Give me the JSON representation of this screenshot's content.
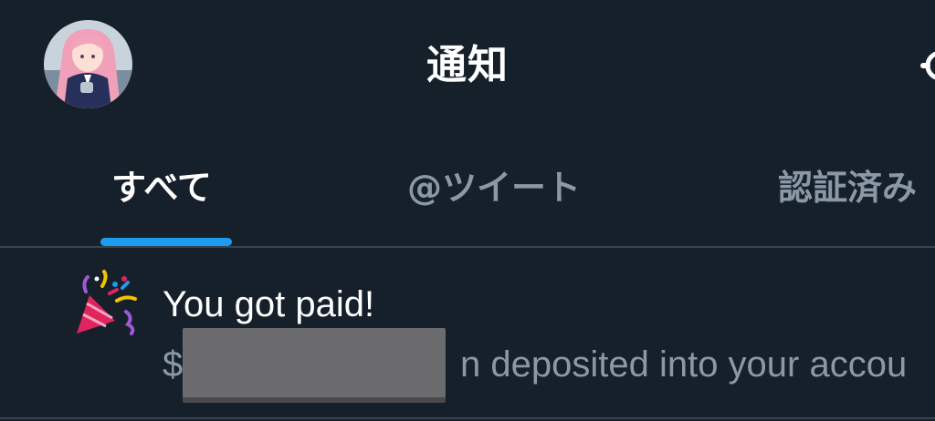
{
  "header": {
    "title": "通知"
  },
  "tabs": [
    {
      "label": "すべて",
      "selected": true
    },
    {
      "label": "@ツイート",
      "selected": false
    },
    {
      "label": "認証済み",
      "selected": false
    }
  ],
  "notification": {
    "icon": "party-popper-icon",
    "title": "You got paid!",
    "body_prefix": "$",
    "body_suffix": "n deposited into your accou"
  },
  "colors": {
    "background": "#15202b",
    "accent": "#1d9bf0",
    "secondary_text": "#8b98a5",
    "divider": "#38444d"
  }
}
